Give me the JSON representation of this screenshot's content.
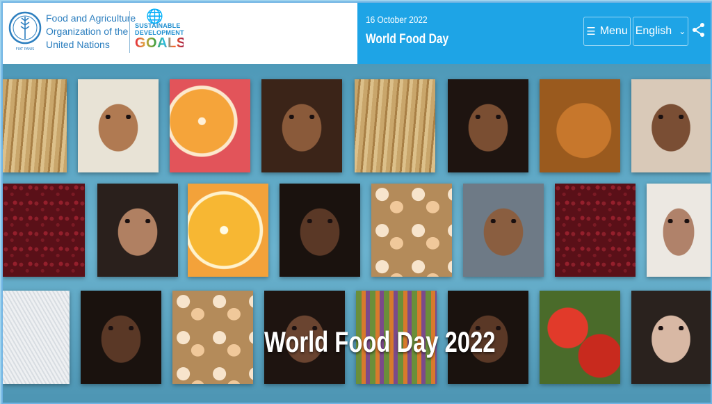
{
  "header": {
    "org_name_line1": "Food and Agriculture",
    "org_name_line2": "Organization of the",
    "org_name_line3": "United Nations",
    "sdg_line1": "SUSTAINABLE",
    "sdg_line2": "DEVELOPMENT",
    "sdg_goals": "GOALS",
    "fao_logo_letters": "FAO",
    "fao_logo_motto": "FIAT PANIS",
    "event_date": "16 October 2022",
    "event_name": "World Food Day",
    "menu_label": "Menu",
    "language_label": "English",
    "icons": {
      "menu": "hamburger-icon",
      "language": "chevron-down-icon",
      "share": "share-icon"
    }
  },
  "hero": {
    "title": "World Food Day 2022"
  },
  "colors": {
    "header_blue": "#1ea4e6",
    "fao_blue": "#2d7fbf",
    "mosaic_bg": "#5aa3c0"
  }
}
